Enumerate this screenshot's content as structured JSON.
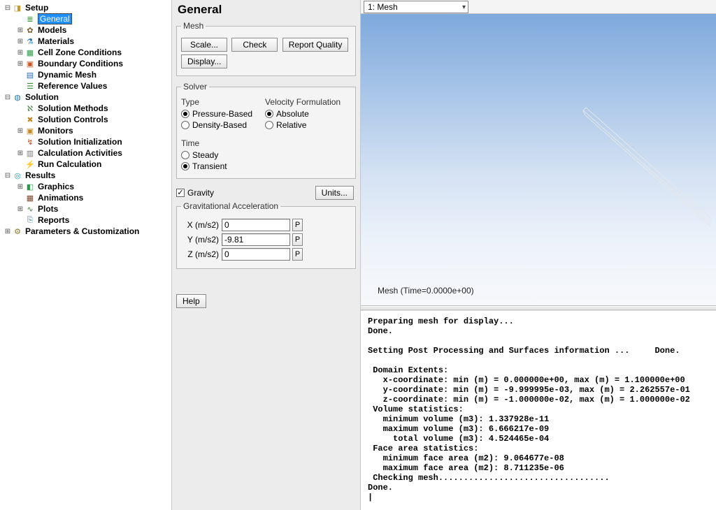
{
  "tree": {
    "setup": "Setup",
    "general": "General",
    "models": "Models",
    "materials": "Materials",
    "cellzone": "Cell Zone Conditions",
    "bc": "Boundary Conditions",
    "dynmesh": "Dynamic Mesh",
    "refvals": "Reference Values",
    "solution": "Solution",
    "solmethods": "Solution Methods",
    "solcontrols": "Solution Controls",
    "monitors": "Monitors",
    "solinit": "Solution Initialization",
    "calcact": "Calculation Activities",
    "runcalc": "Run Calculation",
    "results": "Results",
    "graphics": "Graphics",
    "animations": "Animations",
    "plots": "Plots",
    "reports": "Reports",
    "params": "Parameters & Customization"
  },
  "mid": {
    "title": "General",
    "mesh": {
      "legend": "Mesh",
      "scale": "Scale...",
      "check": "Check",
      "rq": "Report Quality",
      "display": "Display..."
    },
    "solver": {
      "legend": "Solver",
      "type_hdr": "Type",
      "pbased": "Pressure-Based",
      "dbased": "Density-Based",
      "vel_hdr": "Velocity Formulation",
      "abs": "Absolute",
      "rel": "Relative",
      "time_hdr": "Time",
      "steady": "Steady",
      "transient": "Transient"
    },
    "gravity_label": "Gravity",
    "units_btn": "Units...",
    "gravaccel_hdr": "Gravitational Acceleration",
    "gx_label": "X (m/s2)",
    "gy_label": "Y (m/s2)",
    "gz_label": "Z (m/s2)",
    "gx": "0",
    "gy": "-9.81",
    "gz": "0",
    "p": "P",
    "help": "Help"
  },
  "right": {
    "viewsel": "1: Mesh",
    "meshlabel": "Mesh (Time=0.0000e+00)",
    "console": "Preparing mesh for display...\nDone.\n\nSetting Post Processing and Surfaces information ...     Done.\n\n Domain Extents:\n   x-coordinate: min (m) = 0.000000e+00, max (m) = 1.100000e+00\n   y-coordinate: min (m) = -9.999995e-03, max (m) = 2.262557e-01\n   z-coordinate: min (m) = -1.000000e-02, max (m) = 1.000000e-02\n Volume statistics:\n   minimum volume (m3): 1.337928e-11\n   maximum volume (m3): 6.666217e-09\n     total volume (m3): 4.524465e-04\n Face area statistics:\n   minimum face area (m2): 9.064677e-08\n   maximum face area (m2): 8.711235e-06\n Checking mesh..................................\nDone.\n|"
  }
}
